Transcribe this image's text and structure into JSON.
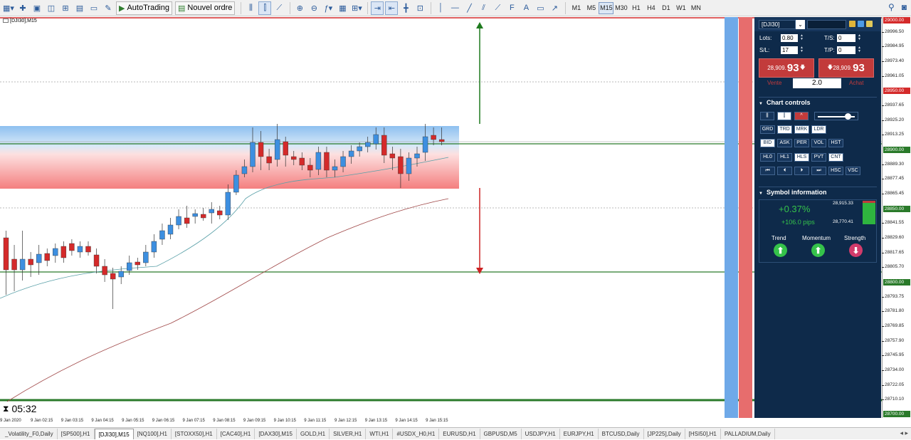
{
  "toolbar": {
    "autotrading_label": "AutoTrading",
    "new_order_label": "Nouvel ordre",
    "timeframes": [
      "M1",
      "M5",
      "M15",
      "M30",
      "H1",
      "H4",
      "D1",
      "W1",
      "MN"
    ],
    "active_timeframe": "M15"
  },
  "chart": {
    "symbol_label": "[DJI30],M15",
    "timer": "05:32",
    "price_labels": [
      "29000.00",
      "28996.50",
      "28984.95",
      "28973.40",
      "28961.05",
      "28950.00",
      "28937.65",
      "28925.20",
      "28913.25",
      "28900.00",
      "28889.30",
      "28877.45",
      "28865.45",
      "28850.00",
      "28841.55",
      "28829.60",
      "28817.65",
      "28805.70",
      "28800.00",
      "28793.75",
      "28781.80",
      "28769.85",
      "28757.90",
      "28745.95",
      "28734.00",
      "28722.05",
      "28710.10",
      "28700.00"
    ],
    "time_labels": [
      "9 Jan 2020",
      "9 Jan 02:15",
      "9 Jan 03:15",
      "9 Jan 04:15",
      "9 Jan 05:15",
      "9 Jan 06:15",
      "9 Jan 07:15",
      "9 Jan 08:15",
      "9 Jan 09:15",
      "9 Jan 10:15",
      "9 Jan 11:15",
      "9 Jan 12:15",
      "9 Jan 13:15",
      "9 Jan 14:15",
      "9 Jan 15:15"
    ],
    "colors": {
      "bull": "#3d8fe0",
      "bear": "#d42a2a",
      "ma_fast": "#5aa0a8",
      "ma_slow": "#a04848",
      "green_line": "#2a7a2a"
    }
  },
  "panel": {
    "symbol": "[DJI30]",
    "lots_label": "Lots:",
    "lots_value": "0.80",
    "ts_label": "T/S:",
    "ts_value": "0",
    "sl_label": "S/L:",
    "sl_value": "17",
    "tp_label": "T/P:",
    "tp_value": "0",
    "sell_small": "28,909.",
    "sell_big": "93",
    "sell_label": "Vente",
    "buy_small": "28,909.",
    "buy_big": "93",
    "buy_label": "Achat",
    "volume": "2.0",
    "chart_controls_title": "Chart controls",
    "row1": [
      "GRD",
      "TRD",
      "MRK",
      "LDR"
    ],
    "row2": [
      "BID",
      "ASK",
      "PER",
      "VOL",
      "HST"
    ],
    "row3": [
      "HL0",
      "HL1",
      "HLS",
      "PVT",
      "CNT"
    ],
    "row4": [
      "⏮",
      "⏴",
      "⏵",
      "⏭",
      "HSC",
      "VSC"
    ],
    "symbol_info_title": "Symbol information",
    "change_pct": "+0.37%",
    "change_pips": "+106.0 pips",
    "high": "28,915.33",
    "low": "28,770.41",
    "trend_label": "Trend",
    "momentum_label": "Momentum",
    "strength_label": "Strength"
  },
  "tabs": [
    "_Volatility_F0,Daily",
    "[SP500],H1",
    "[DJI30],M15",
    "[NQ100],H1",
    "[STOXX50],H1",
    "[CAC40],H1",
    "[DAX30],M15",
    "GOLD,H1",
    "SILVER,H1",
    "WTI,H1",
    "#USDX_H0,H1",
    "EURUSD,H1",
    "GBPUSD,M5",
    "USDJPY,H1",
    "EURJPY,H1",
    "BTCUSD,Daily",
    "[JP225],Daily",
    "[HSI50],H1",
    "PALLADIUM,Daily"
  ],
  "active_tab": "[DJI30],M15"
}
